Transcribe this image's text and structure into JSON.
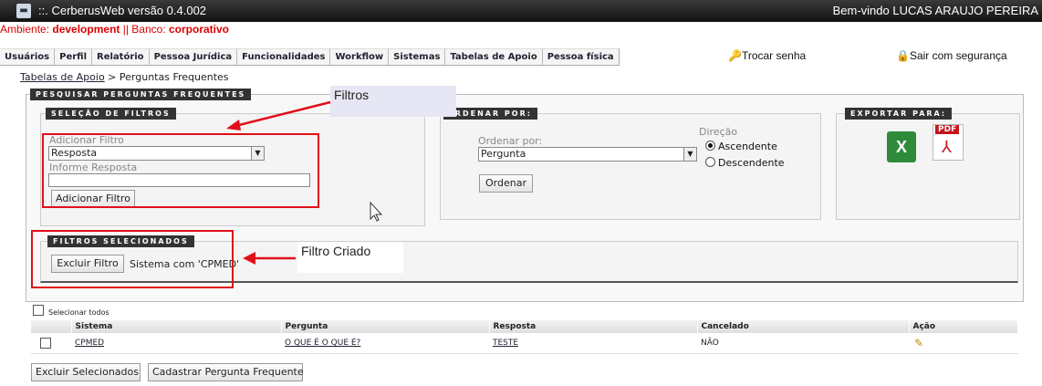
{
  "header": {
    "title": "::.  CerberusWeb versão 0.4.002",
    "welcome": "Bem-vindo LUCAS ARAUJO PEREIRA"
  },
  "env": {
    "prefix": "Ambiente: ",
    "ambiente": "development",
    "sep": " || Banco: ",
    "banco": "corporativo"
  },
  "menu": [
    "Usuários",
    "Perfil",
    "Relatório",
    "Pessoa Jurídica",
    "Funcionalidades",
    "Workflow",
    "Sistemas",
    "Tabelas de Apoio",
    "Pessoa física"
  ],
  "links": {
    "change_password": "Trocar senha",
    "logout": "Sair com segurança"
  },
  "breadcrumb": {
    "parent": "Tabelas de Apoio",
    "sep": " > ",
    "current": "Perguntas Frequentes"
  },
  "search": {
    "title": "PESQUISAR PERGUNTAS FREQUENTES",
    "filters_title": "SELEÇÃO DE FILTROS",
    "add_filter_label": "Adicionar Filtro",
    "add_filter_value": "Resposta",
    "answer_label": "Informe Resposta",
    "answer_value": "",
    "add_filter_button": "Adicionar Filtro",
    "order_title": "ORDENAR POR:",
    "order_label": "Ordenar por:",
    "order_value": "Pergunta",
    "direction_label": "Direção",
    "asc": "Ascendente",
    "desc": "Descendente",
    "order_button": "Ordenar",
    "export_title": "EXPORTAR PARA:",
    "pdf_label": "PDF"
  },
  "selected": {
    "title": "FILTROS SELECIONADOS",
    "remove_button": "Excluir Filtro",
    "filter_text": "Sistema com 'CPMED'"
  },
  "annotations": {
    "filters": "Filtros",
    "created": "Filtro Criado"
  },
  "table": {
    "select_all": "Selecionar todos",
    "headers": [
      "Sistema",
      "Pergunta",
      "Resposta",
      "Cancelado",
      "Ação"
    ],
    "rows": [
      {
        "sistema": "CPMED",
        "pergunta": "O QUE É O QUE É?",
        "resposta": "TESTE",
        "cancelado": "NÃO"
      }
    ]
  },
  "actions": {
    "delete_selected": "Excluir Selecionados",
    "register": "Cadastrar Pergunta Frequente"
  },
  "colors": {
    "accent_red": "#e0101a",
    "env_red": "#dd0000",
    "header_dark": "#111111"
  }
}
